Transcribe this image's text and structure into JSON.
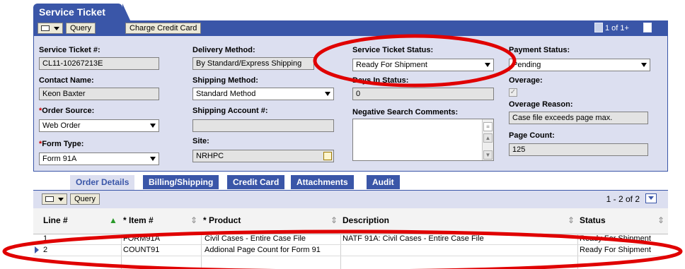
{
  "header": {
    "title": "Service Ticket",
    "query_label": "Query",
    "charge_label": "Charge Credit Card",
    "pager_text": "1 of 1+"
  },
  "form": {
    "service_ticket_label": "Service Ticket #:",
    "service_ticket_value": "CL11-10267213E",
    "contact_label": "Contact Name:",
    "contact_value": "Keon Baxter",
    "order_source_label": "Order Source:",
    "order_source_value": "Web Order",
    "form_type_label": "Form Type:",
    "form_type_value": "Form 91A",
    "delivery_label": "Delivery Method:",
    "delivery_value": "By Standard/Express Shipping",
    "shipping_method_label": "Shipping Method:",
    "shipping_method_value": "Standard Method",
    "shipping_account_label": "Shipping Account #:",
    "shipping_account_value": "",
    "site_label": "Site:",
    "site_value": "NRHPC",
    "status_label": "Service Ticket Status:",
    "status_value": "Ready For Shipment",
    "days_label": "Days In Status:",
    "days_value": "0",
    "negative_label": "Negative Search Comments:",
    "payment_label": "Payment Status:",
    "payment_value": "Pending",
    "overage_label": "Overage:",
    "overage_checked": true,
    "overage_reason_label": "Overage Reason:",
    "overage_reason_value": "Case file exceeds page max.",
    "page_count_label": "Page Count:",
    "page_count_value": "125",
    "required_mark": "*"
  },
  "tabs": [
    {
      "label": "Order Details",
      "active": true
    },
    {
      "label": "Billing/Shipping",
      "active": false
    },
    {
      "label": "Credit Card",
      "active": false
    },
    {
      "label": "Attachments",
      "active": false
    },
    {
      "label": "Audit",
      "active": false
    }
  ],
  "list": {
    "query_label": "Query",
    "page_count": "1 - 2 of 2",
    "columns": [
      "Line #",
      "Item #",
      "Product",
      "Description",
      "Status"
    ],
    "required_mark": "*",
    "rows": [
      {
        "line": "1",
        "item": "FORM91A",
        "product": "Civil Cases - Entire Case File",
        "description": "NATF 91A: Civil Cases - Entire Case File",
        "status": "Ready For Shipment"
      },
      {
        "line": "2",
        "item": "COUNT91",
        "product": "Addional Page Count for Form 91",
        "description": "",
        "status": "Ready For Shipment"
      }
    ]
  },
  "colors": {
    "brand_blue": "#3a56a8",
    "panel_bg": "#dcdff0",
    "annotation_red": "#e00000"
  }
}
